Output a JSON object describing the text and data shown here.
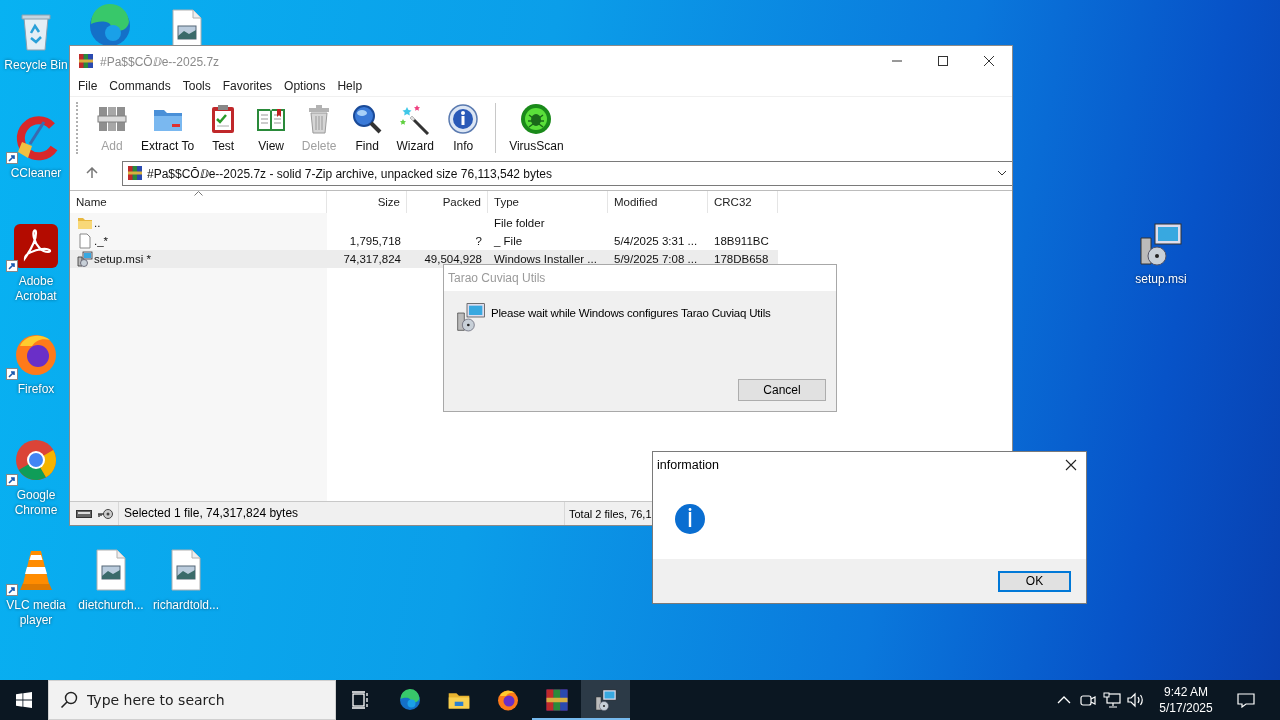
{
  "desktop_icons": [
    {
      "label": "Recycle Bin",
      "shortcut": false
    },
    {
      "shortcut": false
    },
    {
      "shortcut": false
    },
    {
      "label": "CCleaner",
      "shortcut": true
    },
    {
      "label": "Adobe Acrobat",
      "shortcut": true
    },
    {
      "label": "Firefox",
      "shortcut": true
    },
    {
      "label": "Google Chrome",
      "shortcut": true
    },
    {
      "label": "VLC media player",
      "shortcut": true
    },
    {
      "label": "dietchurch...",
      "shortcut": false
    },
    {
      "label": "richardtold...",
      "shortcut": false
    },
    {
      "label": "setup.msi",
      "shortcut": false
    }
  ],
  "archive_window": {
    "title": "#Pa$$CŌⅅe--2025.7z",
    "menu": [
      "File",
      "Commands",
      "Tools",
      "Favorites",
      "Options",
      "Help"
    ],
    "toolbar": [
      {
        "label": "Add",
        "disabled": true
      },
      {
        "label": "Extract To",
        "disabled": false
      },
      {
        "label": "Test",
        "disabled": false
      },
      {
        "label": "View",
        "disabled": false
      },
      {
        "label": "Delete",
        "disabled": true
      },
      {
        "label": "Find",
        "disabled": false
      },
      {
        "label": "Wizard",
        "disabled": false
      },
      {
        "label": "Info",
        "disabled": false
      },
      {
        "label": "VirusScan",
        "disabled": false
      }
    ],
    "address": "#Pa$$CŌⅅe--2025.7z - solid 7-Zip archive, unpacked size 76,113,542 bytes",
    "columns": [
      {
        "label": "Name",
        "sorted": true
      },
      {
        "label": "Size",
        "sorted": false
      },
      {
        "label": "Packed",
        "sorted": false
      },
      {
        "label": "Type",
        "sorted": false
      },
      {
        "label": "Modified",
        "sorted": false
      },
      {
        "label": "CRC32",
        "sorted": false
      }
    ],
    "rows": [
      {
        "kind": "folder",
        "name": "..",
        "type": "File folder",
        "selected": false
      },
      {
        "kind": "file",
        "name": "._*",
        "size": "1,795,718",
        "packed": "?",
        "type": "_ File",
        "modified": "5/4/2025 3:31 ...",
        "crc32": "18B911BC",
        "selected": false
      },
      {
        "kind": "installer",
        "name": "setup.msi *",
        "size": "74,317,824",
        "packed": "49,504,928",
        "type": "Windows Installer ...",
        "modified": "5/9/2025 7:08 ...",
        "crc32": "178DB658",
        "selected": true
      }
    ],
    "status_bar": {
      "selection": "Selected 1 file, 74,317,824 bytes",
      "total": "Total 2 files, 76,1"
    }
  },
  "installer_dialog": {
    "title": "Tarao Cuviaq Utils",
    "message": "Please wait while Windows configures Tarao Cuviaq Utils",
    "buttons": [
      "Cancel"
    ]
  },
  "info_dialog": {
    "title": "information",
    "buttons": [
      "OK"
    ]
  },
  "taskbar": {
    "search": {
      "placeholder": "Type here to search"
    },
    "apps": [
      {
        "running": false,
        "selected": false
      },
      {
        "running": false,
        "selected": false
      },
      {
        "running": false,
        "selected": false
      },
      {
        "running": true,
        "selected": false
      },
      {
        "running": true,
        "selected": true
      }
    ],
    "clock": {
      "time": "9:42 AM",
      "date": "5/17/2025"
    }
  }
}
